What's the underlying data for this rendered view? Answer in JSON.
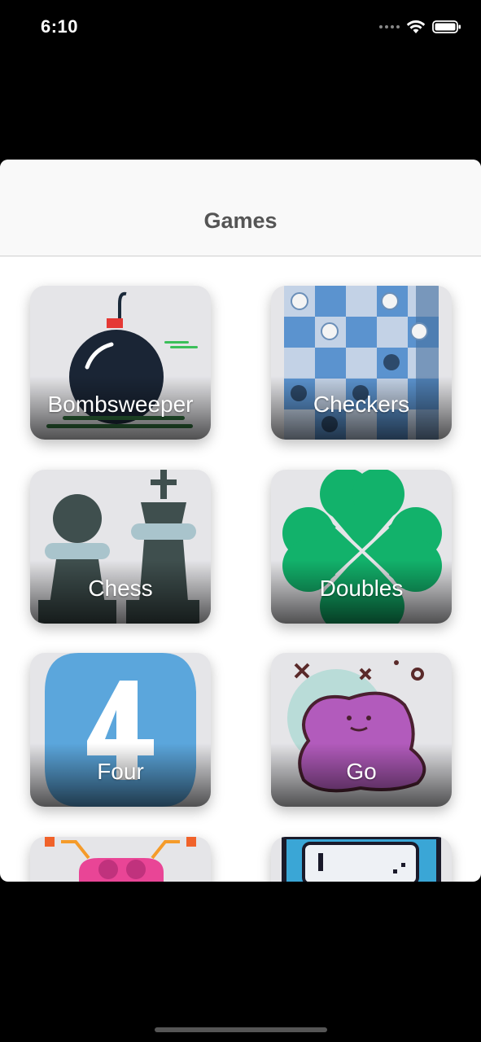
{
  "status_bar": {
    "time": "6:10"
  },
  "sheet": {
    "title": "Games"
  },
  "games": [
    {
      "label": "Bombsweeper",
      "icon": "bomb-icon"
    },
    {
      "label": "Checkers",
      "icon": "checkers-board-icon"
    },
    {
      "label": "Chess",
      "icon": "chess-pieces-icon"
    },
    {
      "label": "Doubles",
      "icon": "four-leaf-clover-icon"
    },
    {
      "label": "Four",
      "icon": "number-four-icon"
    },
    {
      "label": "Go",
      "icon": "purple-blob-icon"
    },
    {
      "label": "",
      "icon": "pink-invader-icon"
    },
    {
      "label": "",
      "icon": "pixel-screen-icon"
    }
  ],
  "colors": {
    "background": "#000000",
    "sheet": "#ffffff",
    "header": "#f9f9f9",
    "title": "#555555",
    "tile": "#e5e5e8"
  }
}
